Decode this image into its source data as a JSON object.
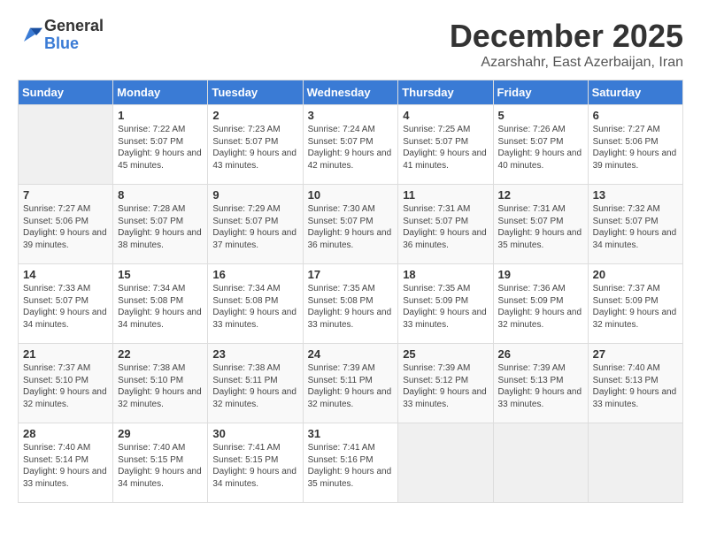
{
  "logo": {
    "general": "General",
    "blue": "Blue"
  },
  "header": {
    "month": "December 2025",
    "location": "Azarshahr, East Azerbaijan, Iran"
  },
  "weekdays": [
    "Sunday",
    "Monday",
    "Tuesday",
    "Wednesday",
    "Thursday",
    "Friday",
    "Saturday"
  ],
  "weeks": [
    [
      {
        "day": "",
        "sunrise": "",
        "sunset": "",
        "daylight": ""
      },
      {
        "day": "1",
        "sunrise": "Sunrise: 7:22 AM",
        "sunset": "Sunset: 5:07 PM",
        "daylight": "Daylight: 9 hours and 45 minutes."
      },
      {
        "day": "2",
        "sunrise": "Sunrise: 7:23 AM",
        "sunset": "Sunset: 5:07 PM",
        "daylight": "Daylight: 9 hours and 43 minutes."
      },
      {
        "day": "3",
        "sunrise": "Sunrise: 7:24 AM",
        "sunset": "Sunset: 5:07 PM",
        "daylight": "Daylight: 9 hours and 42 minutes."
      },
      {
        "day": "4",
        "sunrise": "Sunrise: 7:25 AM",
        "sunset": "Sunset: 5:07 PM",
        "daylight": "Daylight: 9 hours and 41 minutes."
      },
      {
        "day": "5",
        "sunrise": "Sunrise: 7:26 AM",
        "sunset": "Sunset: 5:07 PM",
        "daylight": "Daylight: 9 hours and 40 minutes."
      },
      {
        "day": "6",
        "sunrise": "Sunrise: 7:27 AM",
        "sunset": "Sunset: 5:06 PM",
        "daylight": "Daylight: 9 hours and 39 minutes."
      }
    ],
    [
      {
        "day": "7",
        "sunrise": "Sunrise: 7:27 AM",
        "sunset": "Sunset: 5:06 PM",
        "daylight": "Daylight: 9 hours and 39 minutes."
      },
      {
        "day": "8",
        "sunrise": "Sunrise: 7:28 AM",
        "sunset": "Sunset: 5:07 PM",
        "daylight": "Daylight: 9 hours and 38 minutes."
      },
      {
        "day": "9",
        "sunrise": "Sunrise: 7:29 AM",
        "sunset": "Sunset: 5:07 PM",
        "daylight": "Daylight: 9 hours and 37 minutes."
      },
      {
        "day": "10",
        "sunrise": "Sunrise: 7:30 AM",
        "sunset": "Sunset: 5:07 PM",
        "daylight": "Daylight: 9 hours and 36 minutes."
      },
      {
        "day": "11",
        "sunrise": "Sunrise: 7:31 AM",
        "sunset": "Sunset: 5:07 PM",
        "daylight": "Daylight: 9 hours and 36 minutes."
      },
      {
        "day": "12",
        "sunrise": "Sunrise: 7:31 AM",
        "sunset": "Sunset: 5:07 PM",
        "daylight": "Daylight: 9 hours and 35 minutes."
      },
      {
        "day": "13",
        "sunrise": "Sunrise: 7:32 AM",
        "sunset": "Sunset: 5:07 PM",
        "daylight": "Daylight: 9 hours and 34 minutes."
      }
    ],
    [
      {
        "day": "14",
        "sunrise": "Sunrise: 7:33 AM",
        "sunset": "Sunset: 5:07 PM",
        "daylight": "Daylight: 9 hours and 34 minutes."
      },
      {
        "day": "15",
        "sunrise": "Sunrise: 7:34 AM",
        "sunset": "Sunset: 5:08 PM",
        "daylight": "Daylight: 9 hours and 34 minutes."
      },
      {
        "day": "16",
        "sunrise": "Sunrise: 7:34 AM",
        "sunset": "Sunset: 5:08 PM",
        "daylight": "Daylight: 9 hours and 33 minutes."
      },
      {
        "day": "17",
        "sunrise": "Sunrise: 7:35 AM",
        "sunset": "Sunset: 5:08 PM",
        "daylight": "Daylight: 9 hours and 33 minutes."
      },
      {
        "day": "18",
        "sunrise": "Sunrise: 7:35 AM",
        "sunset": "Sunset: 5:09 PM",
        "daylight": "Daylight: 9 hours and 33 minutes."
      },
      {
        "day": "19",
        "sunrise": "Sunrise: 7:36 AM",
        "sunset": "Sunset: 5:09 PM",
        "daylight": "Daylight: 9 hours and 32 minutes."
      },
      {
        "day": "20",
        "sunrise": "Sunrise: 7:37 AM",
        "sunset": "Sunset: 5:09 PM",
        "daylight": "Daylight: 9 hours and 32 minutes."
      }
    ],
    [
      {
        "day": "21",
        "sunrise": "Sunrise: 7:37 AM",
        "sunset": "Sunset: 5:10 PM",
        "daylight": "Daylight: 9 hours and 32 minutes."
      },
      {
        "day": "22",
        "sunrise": "Sunrise: 7:38 AM",
        "sunset": "Sunset: 5:10 PM",
        "daylight": "Daylight: 9 hours and 32 minutes."
      },
      {
        "day": "23",
        "sunrise": "Sunrise: 7:38 AM",
        "sunset": "Sunset: 5:11 PM",
        "daylight": "Daylight: 9 hours and 32 minutes."
      },
      {
        "day": "24",
        "sunrise": "Sunrise: 7:39 AM",
        "sunset": "Sunset: 5:11 PM",
        "daylight": "Daylight: 9 hours and 32 minutes."
      },
      {
        "day": "25",
        "sunrise": "Sunrise: 7:39 AM",
        "sunset": "Sunset: 5:12 PM",
        "daylight": "Daylight: 9 hours and 33 minutes."
      },
      {
        "day": "26",
        "sunrise": "Sunrise: 7:39 AM",
        "sunset": "Sunset: 5:13 PM",
        "daylight": "Daylight: 9 hours and 33 minutes."
      },
      {
        "day": "27",
        "sunrise": "Sunrise: 7:40 AM",
        "sunset": "Sunset: 5:13 PM",
        "daylight": "Daylight: 9 hours and 33 minutes."
      }
    ],
    [
      {
        "day": "28",
        "sunrise": "Sunrise: 7:40 AM",
        "sunset": "Sunset: 5:14 PM",
        "daylight": "Daylight: 9 hours and 33 minutes."
      },
      {
        "day": "29",
        "sunrise": "Sunrise: 7:40 AM",
        "sunset": "Sunset: 5:15 PM",
        "daylight": "Daylight: 9 hours and 34 minutes."
      },
      {
        "day": "30",
        "sunrise": "Sunrise: 7:41 AM",
        "sunset": "Sunset: 5:15 PM",
        "daylight": "Daylight: 9 hours and 34 minutes."
      },
      {
        "day": "31",
        "sunrise": "Sunrise: 7:41 AM",
        "sunset": "Sunset: 5:16 PM",
        "daylight": "Daylight: 9 hours and 35 minutes."
      },
      {
        "day": "",
        "sunrise": "",
        "sunset": "",
        "daylight": ""
      },
      {
        "day": "",
        "sunrise": "",
        "sunset": "",
        "daylight": ""
      },
      {
        "day": "",
        "sunrise": "",
        "sunset": "",
        "daylight": ""
      }
    ]
  ]
}
